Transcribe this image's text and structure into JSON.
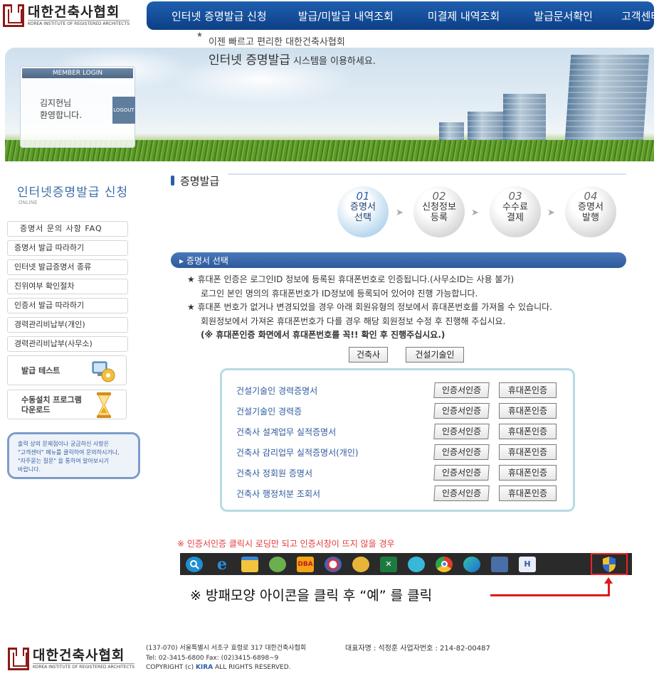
{
  "header": {
    "logo_text_ko": "대한건축사협회",
    "logo_text_en": "KOREA INSTITUTE OF REGISTERED ARCHITECTS",
    "nav": [
      "인터넷 증명발급 신청",
      "발급/미발급 내역조회",
      "미결제 내역조회",
      "발급문서확인",
      "고객센터"
    ]
  },
  "banner": {
    "login_title": "MEMBER LOGIN",
    "user_name": "김지현님",
    "welcome": "환영합니다.",
    "logout_label": "LOGOUT",
    "line1": "이젠 빠르고 편리한 대한건축사협회",
    "line2_main": "인터넷 증명발급",
    "line2_rest": " 시스템을 이용하세요."
  },
  "sidebar": {
    "title": "인터넷증명발급 신청",
    "subtitle": "ONLINE",
    "items": [
      "증명서 문의 사항 FAQ",
      "증명서 발급 따라하기",
      "인터넷 발급증명서 종류",
      "진위여부 확인절차",
      "인증서 발급 따라하기",
      "경력관리비납부(개인)",
      "경력관리비납부(사무소)"
    ],
    "card1_label": "발급 테스트",
    "card2_label1": "수동설치 프로그램",
    "card2_label2": "다운로드",
    "help_lines": [
      "출력 상의 문제점이나 궁금하신 사항은",
      "\"고객센터\" 메뉴를 클릭하여 문의하시거나,",
      "\"자주묻는 질문\" 을 통하여 알아보시기",
      "바랍니다."
    ]
  },
  "main": {
    "page_title": "증명발급",
    "steps": [
      {
        "num": "01",
        "line1": "증명서",
        "line2": "선택",
        "active": true
      },
      {
        "num": "02",
        "line1": "신청정보",
        "line2": "등록",
        "active": false
      },
      {
        "num": "03",
        "line1": "수수료",
        "line2": "결제",
        "active": false
      },
      {
        "num": "04",
        "line1": "증명서",
        "line2": "발행",
        "active": false
      }
    ],
    "section_title": "▸ 증명서 선택",
    "notes": {
      "n1": "★ 휴대폰 인증은 로그인ID 정보에 등록된 휴대폰번호로 인증됩니다.(사무소ID는 사용 불가)",
      "n1b": "로그인 본인 명의의 휴대폰번호가 ID정보에 등록되어 있어야 진행 가능합니다.",
      "n2": "★ 휴대폰 번호가 없거나 변경되었을 경우 아래 회원유형의 정보에서 휴대폰번호를 가져올 수 있습니다.",
      "n2b": "회원정보에서 가져온 휴대폰번호가 다를 경우 해당 회원정보 수정 후 진행해 주십시요.",
      "n3": "(※ 휴대폰인증 화면에서 휴대폰번호를 꼭!! 확인 후 진행주십시요.)"
    },
    "toggle_architect": "건축사",
    "toggle_engineer": "건설기술인",
    "certs": [
      "건설기술인 경력증명서",
      "건설기술인 경력증",
      "건축사 설계업무 실적증명서",
      "건축사 감리업무 실적증명서(개인)",
      "건축사 정회원 증명서",
      "건축사 행정처분 조회서"
    ],
    "cert_btn_label": "인증서인증",
    "phone_btn_label": "휴대폰인증",
    "warning": "※ 인증서인증 클릭시 로딩만 되고 인증서창이 뜨지 않을 경우",
    "instruction": "※ 방패모양 아이콘을 클릭 후 “예” 를 클릭",
    "taskbar_icons": [
      "search-icon",
      "ie-icon",
      "file-explorer-icon",
      "frog-icon",
      "dba-icon",
      "ball-icon",
      "badge-icon",
      "excel-icon",
      "bird-icon",
      "chrome-icon",
      "edge-icon",
      "network-icon",
      "h-icon",
      "shield-icon"
    ],
    "dba_text": "DBA",
    "h_text": "H"
  },
  "footer": {
    "logo_text_ko": "대한건축사협회",
    "logo_text_en": "KOREA INSTITUTE OF REGISTERED ARCHITECTS",
    "address": "(137-070) 서울특별시 서초구 효령로 317 대한건축사협회",
    "rep": "대표자명 : 석정훈 사업자번호 : 214-82-00487",
    "tel": "Tel: 02-3415-6800  Fax: (02)3415-6898~9",
    "copyright_pre": "COPYRIGHT (c) ",
    "copyright_kira": "KIRA",
    "copyright_post": " ALL RIGHTS RESERVED."
  },
  "colors": {
    "nav_blue": "#1a4f9c",
    "accent_red": "#e01919",
    "link_blue": "#2d5a9c"
  }
}
